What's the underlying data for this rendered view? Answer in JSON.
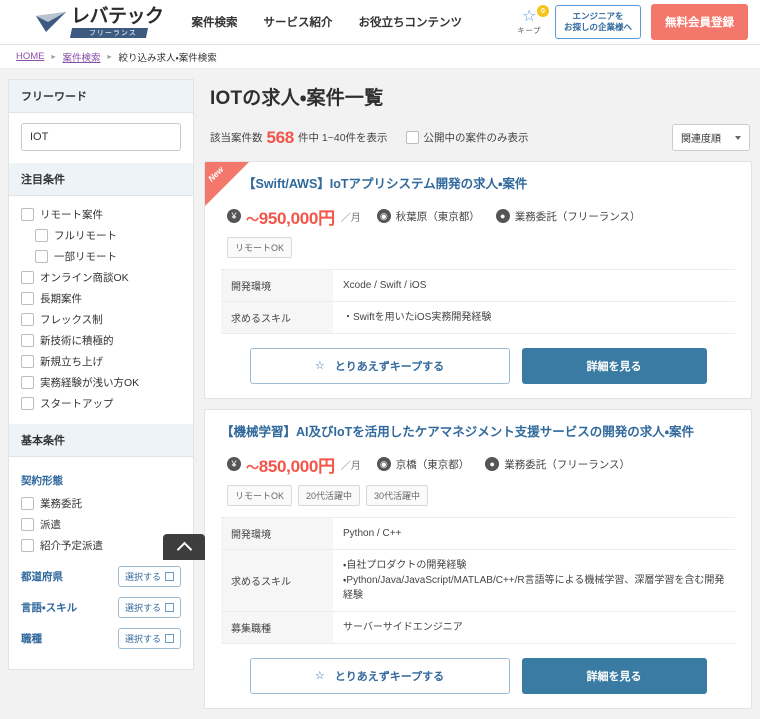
{
  "header": {
    "logo_main": "レバテック",
    "logo_sub": "フリーランス",
    "nav": [
      {
        "label": "案件検索"
      },
      {
        "label": "サービス紹介"
      },
      {
        "label": "お役立ちコンテンツ"
      }
    ],
    "keep": {
      "label": "キープ",
      "count": "0",
      "icon": "star-outline-icon"
    },
    "company_button": "エンジニアを\nお探しの企業様へ",
    "register_button": "無料会員登録",
    "accent_red": "#f4776b",
    "accent_blue": "#31699c"
  },
  "breadcrumb": {
    "home": "HOME",
    "second": "案件検索",
    "current": "絞り込み求人・案件検索"
  },
  "sidebar": {
    "freeword": {
      "heading": "フリーワード",
      "value": "IOT",
      "placeholder": "フリーワード"
    },
    "featured": {
      "heading": "注目条件",
      "items": [
        {
          "label": "リモート案件",
          "indent": false
        },
        {
          "label": "フルリモート",
          "indent": true
        },
        {
          "label": "一部リモート",
          "indent": true
        },
        {
          "label": "オンライン商談OK",
          "indent": false
        },
        {
          "label": "長期案件",
          "indent": false
        },
        {
          "label": "フレックス制",
          "indent": false
        },
        {
          "label": "新技術に積極的",
          "indent": false
        },
        {
          "label": "新規立ち上げ",
          "indent": false
        },
        {
          "label": "実務経験が浅い方OK",
          "indent": false
        },
        {
          "label": "スタートアップ",
          "indent": false
        }
      ]
    },
    "basic": {
      "heading": "基本条件",
      "contract_label": "契約形態",
      "contract_items": [
        {
          "label": "業務委託"
        },
        {
          "label": "派遣"
        },
        {
          "label": "紹介予定派遣"
        }
      ],
      "select_rows": [
        {
          "label": "都道府県",
          "button": "選択する"
        },
        {
          "label": "言語・スキル",
          "button": "選択する"
        },
        {
          "label": "職種",
          "button": "選択する"
        }
      ]
    }
  },
  "main": {
    "page_title": "IOTの求人・案件一覧",
    "result_prefix": "該当案件数",
    "result_count": "568",
    "result_suffix": "件中 1~40件を表示",
    "public_only_label": "公開中の案件のみ表示",
    "sort_value": "関連度順"
  },
  "cards": [
    {
      "is_new": true,
      "new_label": "New",
      "title": "【Swift/AWS】IoTアプリシステム開発の求人・案件",
      "salary_prefix": "～",
      "salary": "950,000",
      "salary_unit": "円",
      "salary_per": "／月",
      "location": "秋葉原（東京都）",
      "contract": "業務委託（フリーランス）",
      "tags": [
        "リモートOK"
      ],
      "specs": [
        {
          "label": "開発環境",
          "value": "Xcode / Swift / iOS"
        },
        {
          "label": "求めるスキル",
          "value": "・Swiftを用いたiOS実務開発経験"
        }
      ],
      "keep_button": "とりあえずキープする",
      "detail_button": "詳細を見る"
    },
    {
      "is_new": false,
      "new_label": "",
      "title": "【機械学習】AI及びIoTを活用したケアマネジメント支援サービスの開発の求人・案件",
      "salary_prefix": "～",
      "salary": "850,000",
      "salary_unit": "円",
      "salary_per": "／月",
      "location": "京橋（東京都）",
      "contract": "業務委託（フリーランス）",
      "tags": [
        "リモートOK",
        "20代活躍中",
        "30代活躍中"
      ],
      "specs": [
        {
          "label": "開発環境",
          "value": "Python / C++"
        },
        {
          "label": "求めるスキル",
          "value": "・自社プロダクトの開発経験\n・Python/Java/JavaScript/MATLAB/C++/R言語等による機械学習、深層学習を含む開発経験"
        },
        {
          "label": "募集職種",
          "value": "サーバーサイドエンジニア"
        }
      ],
      "keep_button": "とりあえずキープする",
      "detail_button": "詳細を見る"
    }
  ],
  "scroll_top": {
    "icon": "chevron-up-icon"
  }
}
